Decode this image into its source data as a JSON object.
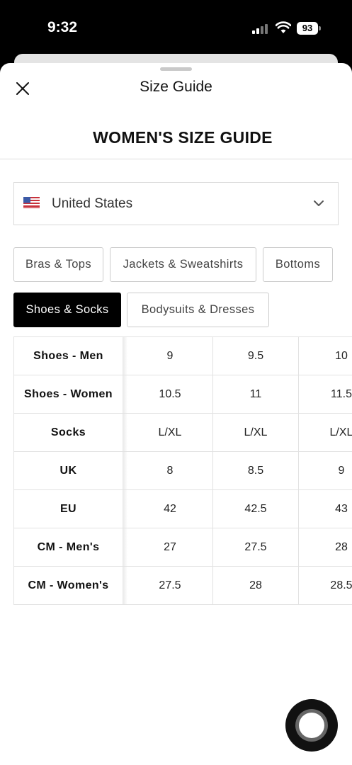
{
  "status_bar": {
    "time": "9:32",
    "battery": "93"
  },
  "sheet": {
    "title": "Size Guide"
  },
  "guide": {
    "heading": "WOMEN'S SIZE GUIDE"
  },
  "country": {
    "selected": "United States"
  },
  "tabs": [
    {
      "label": "Bras & Tops",
      "active": false
    },
    {
      "label": "Jackets & Sweatshirts",
      "active": false
    },
    {
      "label": "Bottoms",
      "active": false
    },
    {
      "label": "Shoes & Socks",
      "active": true
    },
    {
      "label": "Bodysuits & Dresses",
      "active": false
    }
  ],
  "size_table": {
    "rows": [
      {
        "label": "Shoes - Men",
        "values": [
          "9",
          "9.5",
          "10"
        ]
      },
      {
        "label": "Shoes - Women",
        "values": [
          "10.5",
          "11",
          "11.5"
        ]
      },
      {
        "label": "Socks",
        "values": [
          "L/XL",
          "L/XL",
          "L/XL"
        ]
      },
      {
        "label": "UK",
        "values": [
          "8",
          "8.5",
          "9"
        ]
      },
      {
        "label": "EU",
        "values": [
          "42",
          "42.5",
          "43"
        ]
      },
      {
        "label": "CM - Men's",
        "values": [
          "27",
          "27.5",
          "28"
        ]
      },
      {
        "label": "CM - Women's",
        "values": [
          "27.5",
          "28",
          "28.5"
        ]
      }
    ]
  },
  "colors": {
    "active_tab_bg": "#000000",
    "active_tab_text": "#ffffff",
    "border": "#d9d9d9"
  },
  "icons": [
    "close-icon",
    "flag-us-icon",
    "chevron-down-icon",
    "signal-icon",
    "wifi-icon",
    "battery-icon",
    "chat-bubble-icon"
  ]
}
